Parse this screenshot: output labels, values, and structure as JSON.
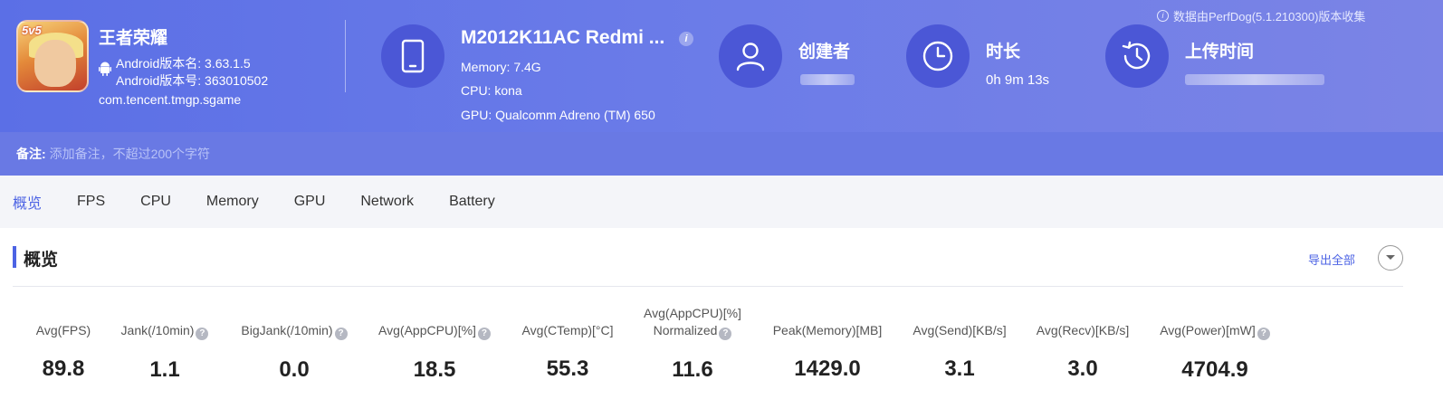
{
  "app": {
    "name": "王者荣耀",
    "version_name": "Android版本名: 3.63.1.5",
    "version_code": "Android版本号: 363010502",
    "package": "com.tencent.tmgp.sgame",
    "icon_badge": "5v5"
  },
  "device": {
    "title": "M2012K11AC Redmi ...",
    "memory": "Memory: 7.4G",
    "cpu": "CPU: kona",
    "gpu": "GPU: Qualcomm Adreno (TM) 650"
  },
  "stats": {
    "creator_label": "创建者",
    "duration_label": "时长",
    "duration_value": "0h 9m 13s",
    "upload_label": "上传时间"
  },
  "source_note": "数据由PerfDog(5.1.210300)版本收集",
  "note": {
    "label": "备注:",
    "placeholder": "添加备注，不超过200个字符"
  },
  "tabs": [
    "概览",
    "FPS",
    "CPU",
    "Memory",
    "GPU",
    "Network",
    "Battery"
  ],
  "active_tab": "概览",
  "section": {
    "title": "概览",
    "export_label": "导出全部"
  },
  "metrics": [
    {
      "label": "Avg(FPS)",
      "value": "89.8",
      "help": false
    },
    {
      "label": "Jank(/10min)",
      "value": "1.1",
      "help": true
    },
    {
      "label": "BigJank(/10min)",
      "value": "0.0",
      "help": true
    },
    {
      "label": "Avg(AppCPU)[%]",
      "value": "18.5",
      "help": true
    },
    {
      "label": "Avg(CTemp)[°C]",
      "value": "55.3",
      "help": false
    },
    {
      "label": "Avg(AppCPU)[%]",
      "label2": "Normalized",
      "value": "11.6",
      "help": true
    },
    {
      "label": "Peak(Memory)[MB]",
      "value": "1429.0",
      "help": false
    },
    {
      "label": "Avg(Send)[KB/s]",
      "value": "3.1",
      "help": false
    },
    {
      "label": "Avg(Recv)[KB/s]",
      "value": "3.0",
      "help": false
    },
    {
      "label": "Avg(Power)[mW]",
      "value": "4704.9",
      "help": true
    }
  ],
  "colors": {
    "accent": "#4c63e4",
    "header_start": "#5b6fe6",
    "header_end": "#7b84e6",
    "icon_circle": "#4b57d6"
  }
}
